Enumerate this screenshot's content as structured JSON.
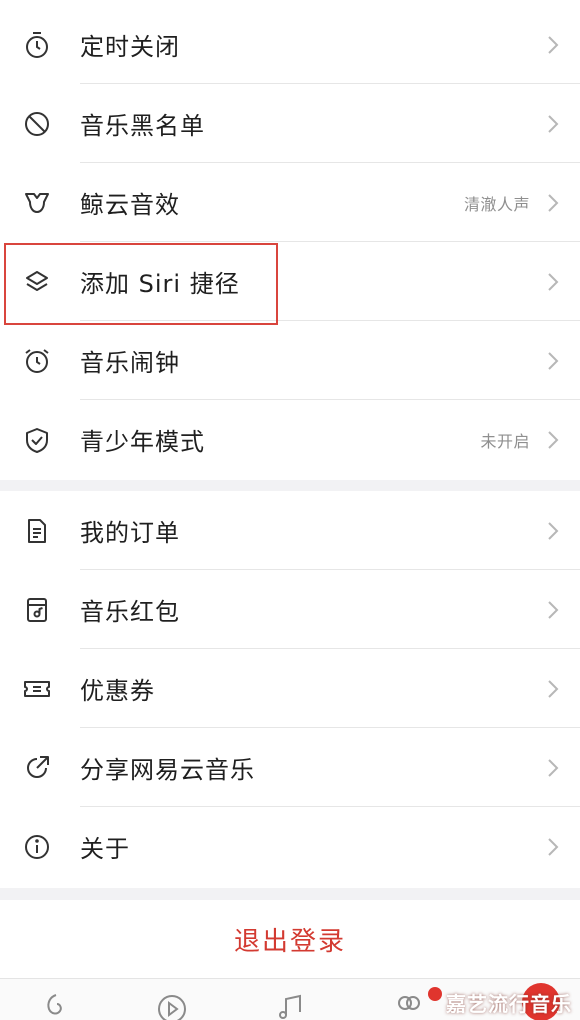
{
  "settings_group_1": [
    {
      "id": "sleep-timer",
      "icon": "timer-icon",
      "label": "定时关闭",
      "value": ""
    },
    {
      "id": "blacklist",
      "icon": "block-icon",
      "label": "音乐黑名单",
      "value": ""
    },
    {
      "id": "sound-effects",
      "icon": "whale-icon",
      "label": "鲸云音效",
      "value": "清澈人声"
    },
    {
      "id": "siri-shortcut",
      "icon": "layers-icon",
      "label": "添加 Siri 捷径",
      "value": ""
    },
    {
      "id": "music-alarm",
      "icon": "alarm-icon",
      "label": "音乐闹钟",
      "value": ""
    },
    {
      "id": "teen-mode",
      "icon": "shield-icon",
      "label": "青少年模式",
      "value": "未开启"
    }
  ],
  "settings_group_2": [
    {
      "id": "my-orders",
      "icon": "document-icon",
      "label": "我的订单",
      "value": ""
    },
    {
      "id": "red-packet",
      "icon": "music-wallet-icon",
      "label": "音乐红包",
      "value": ""
    },
    {
      "id": "coupons",
      "icon": "ticket-icon",
      "label": "优惠券",
      "value": ""
    },
    {
      "id": "share-app",
      "icon": "share-icon",
      "label": "分享网易云音乐",
      "value": ""
    },
    {
      "id": "about",
      "icon": "info-icon",
      "label": "关于",
      "value": ""
    }
  ],
  "logout_label": "退出登录",
  "tabbar": {
    "tabs": [
      "discover-tab-icon",
      "video-tab-icon",
      "music-tab-icon",
      "friends-tab-icon",
      "mine-tab-icon"
    ]
  },
  "watermark": "嘉艺流行音乐",
  "colors": {
    "accent": "#d33a31",
    "highlight_box": "#d9453d",
    "background": "#f2f2f4"
  }
}
